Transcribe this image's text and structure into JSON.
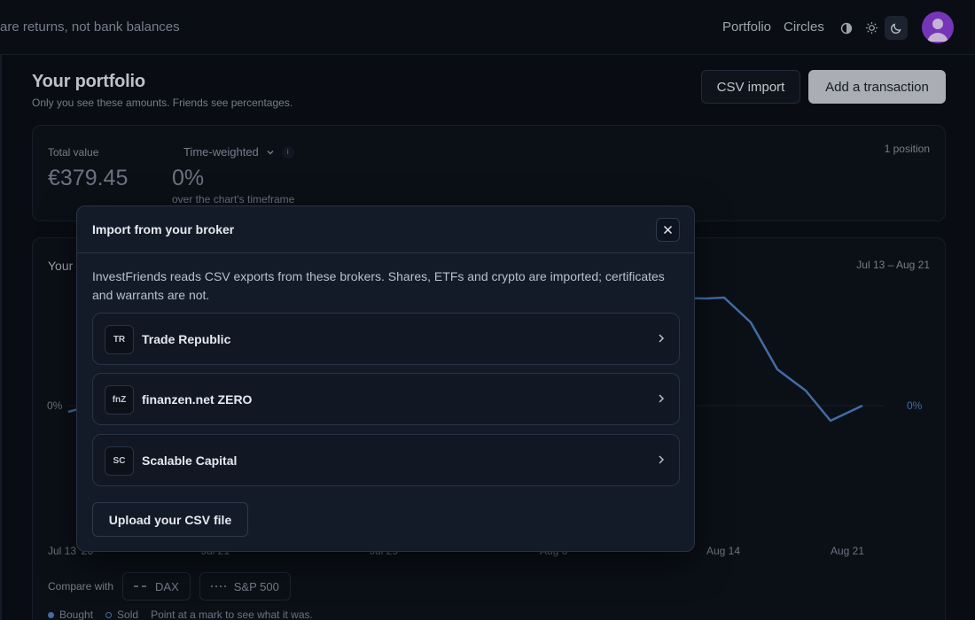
{
  "header": {
    "tagline": "are returns, not bank balances",
    "nav": {
      "portfolio": "Portfolio",
      "circles": "Circles"
    },
    "theme_icons": [
      "contrast-icon",
      "sun-icon",
      "moon-icon"
    ],
    "active_theme": "moon-icon"
  },
  "page": {
    "title": "Your portfolio",
    "subtitle": "Only you see these amounts. Friends see percentages.",
    "csv_import_label": "CSV import",
    "add_transaction_label": "Add a transaction"
  },
  "summary": {
    "total_label": "Total value",
    "total_value": "€379.45",
    "mode_label": "Time-weighted",
    "info_glyph": "i",
    "return_value": "0%",
    "return_sub": "over the chart's timeframe",
    "positions": "1 position"
  },
  "chart": {
    "title": "Your",
    "range": "Jul 13 – Aug 21",
    "left_pct": "0%",
    "right_pct": "0%",
    "x_ticks": [
      "Jul 13 '26",
      "Jul 21",
      "Jul 29",
      "Aug 6",
      "Aug 14",
      "Aug 21"
    ],
    "compare_label": "Compare with",
    "compare_options": [
      "DAX",
      "S&P 500"
    ],
    "legend": {
      "bought": "Bought",
      "sold": "Sold",
      "hint": "Point at a mark to see what it was."
    },
    "line_color": "#4e7fc0"
  },
  "modal": {
    "title": "Import from your broker",
    "description": "InvestFriends reads CSV exports from these brokers. Shares, ETFs and crypto are imported; certificates and warrants are not.",
    "brokers": [
      {
        "badge": "TR",
        "name": "Trade Republic"
      },
      {
        "badge": "fnZ",
        "name": "finanzen.net ZERO"
      },
      {
        "badge": "SC",
        "name": "Scalable Capital"
      }
    ],
    "upload_label": "Upload your CSV file"
  }
}
